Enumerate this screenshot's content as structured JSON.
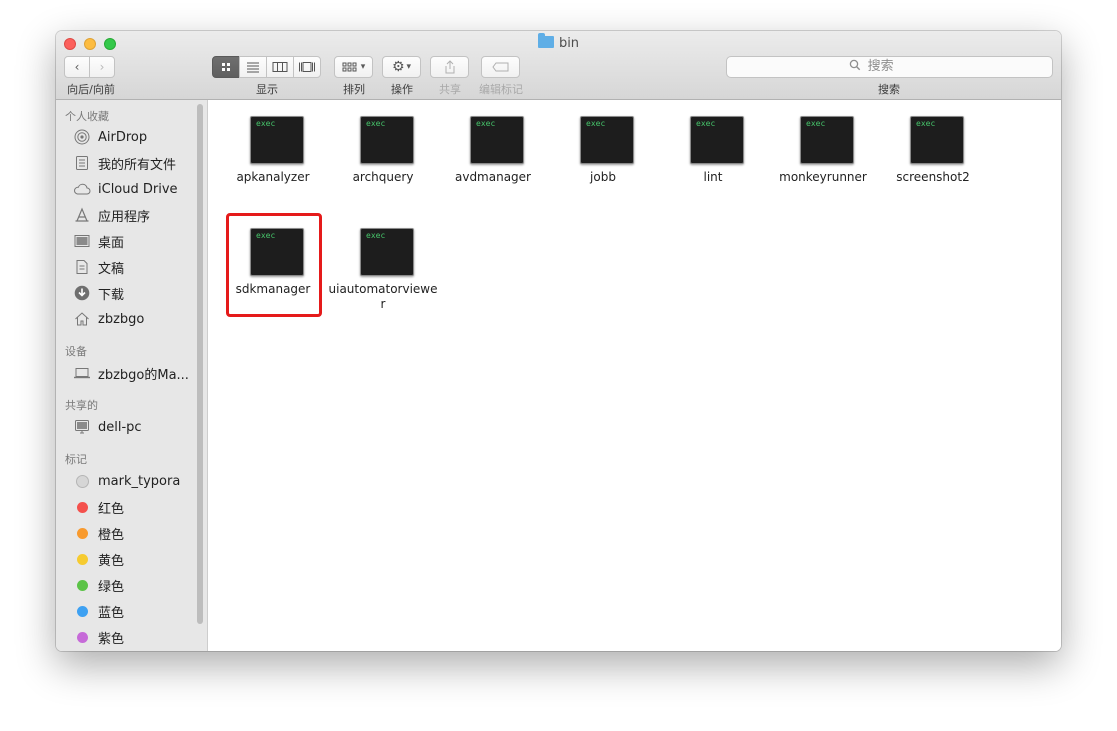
{
  "window": {
    "title": "bin"
  },
  "toolbar": {
    "back_forward_label": "向后/向前",
    "view_label": "显示",
    "arrange_label": "排列",
    "action_label": "操作",
    "share_label": "共享",
    "edit_tags_label": "编辑标记",
    "search_label": "搜索",
    "search_placeholder": "搜索"
  },
  "sidebar": {
    "favorites_header": "个人收藏",
    "favorites": [
      {
        "label": "AirDrop",
        "icon": "airdrop-icon"
      },
      {
        "label": "我的所有文件",
        "icon": "all-files-icon"
      },
      {
        "label": "iCloud Drive",
        "icon": "cloud-icon"
      },
      {
        "label": "应用程序",
        "icon": "applications-icon"
      },
      {
        "label": "桌面",
        "icon": "desktop-icon"
      },
      {
        "label": "文稿",
        "icon": "documents-icon"
      },
      {
        "label": "下载",
        "icon": "download-icon"
      },
      {
        "label": "zbzbgo",
        "icon": "home-icon"
      }
    ],
    "devices_header": "设备",
    "devices": [
      {
        "label": "zbzbgo的Ma...",
        "icon": "laptop-icon"
      }
    ],
    "shared_header": "共享的",
    "shared": [
      {
        "label": "dell-pc",
        "icon": "monitor-icon"
      }
    ],
    "tags_header": "标记",
    "tags": [
      {
        "label": "mark_typora",
        "color": "#d6d6d6"
      },
      {
        "label": "红色",
        "color": "#f4504c"
      },
      {
        "label": "橙色",
        "color": "#f89a2e"
      },
      {
        "label": "黄色",
        "color": "#f6cb30"
      },
      {
        "label": "绿色",
        "color": "#5bc347"
      },
      {
        "label": "蓝色",
        "color": "#3ea1f2"
      },
      {
        "label": "紫色",
        "color": "#c66ad8"
      }
    ]
  },
  "files": [
    {
      "name": "apkanalyzer",
      "badge": "exec"
    },
    {
      "name": "archquery",
      "badge": "exec"
    },
    {
      "name": "avdmanager",
      "badge": "exec"
    },
    {
      "name": "jobb",
      "badge": "exec"
    },
    {
      "name": "lint",
      "badge": "exec"
    },
    {
      "name": "monkeyrunner",
      "badge": "exec"
    },
    {
      "name": "screenshot2",
      "badge": "exec"
    },
    {
      "name": "sdkmanager",
      "badge": "exec",
      "highlighted": true
    },
    {
      "name": "uiautomatorviewer",
      "badge": "exec"
    }
  ]
}
